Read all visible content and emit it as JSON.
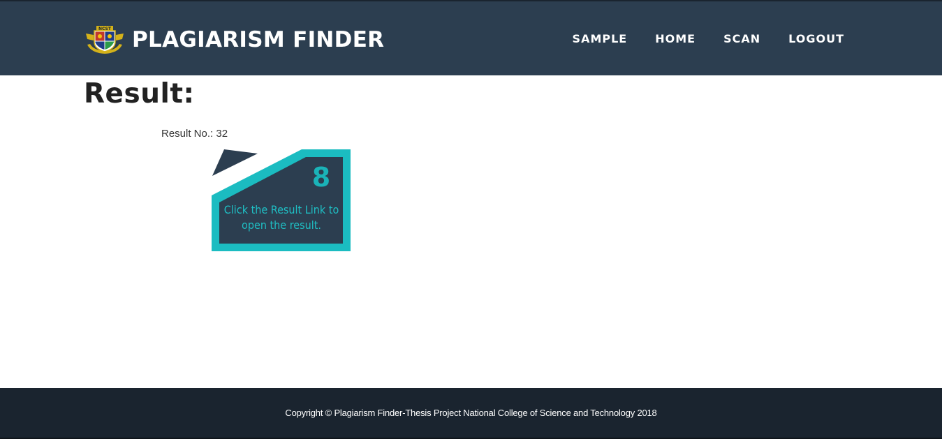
{
  "navbar": {
    "brand_title": "PLAGIARISM FINDER",
    "logo_icon": "ncst-crest-icon",
    "logo_text": "NCST",
    "links": [
      {
        "label": "SAMPLE"
      },
      {
        "label": "HOME"
      },
      {
        "label": "SCAN"
      },
      {
        "label": "LOGOUT"
      }
    ]
  },
  "main": {
    "title": "Result:",
    "result_no_label": "Result No.: 32",
    "card": {
      "number": "8",
      "text": "Click the Result Link to open the result."
    }
  },
  "footer": {
    "copyright": "Copyright © Plagiarism Finder-Thesis Project National College of Science and Technology 2018"
  },
  "colors": {
    "navbar_bg": "#2c3e50",
    "footer_bg": "#1a242f",
    "accent_teal": "#1ab3b8",
    "card_dark": "#2c3e50"
  }
}
